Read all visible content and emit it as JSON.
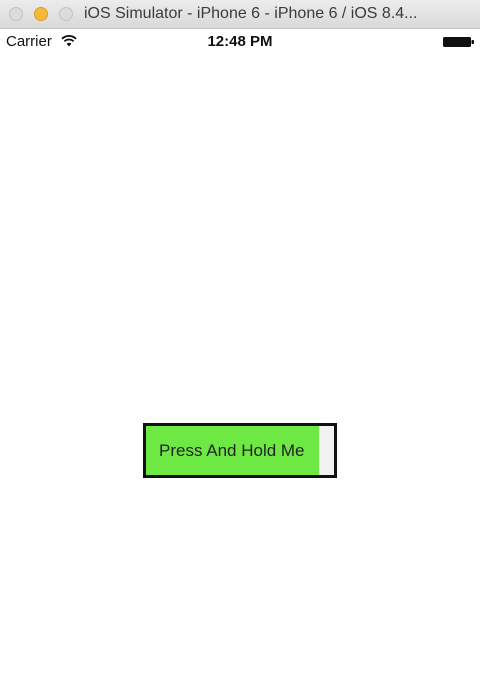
{
  "window": {
    "title": "iOS Simulator - iPhone 6 - iPhone 6 / iOS 8.4..."
  },
  "status_bar": {
    "carrier": "Carrier",
    "time": "12:48 PM",
    "icons": [
      "wifi-icon",
      "battery-icon"
    ]
  },
  "hold_button": {
    "label": "Press And Hold Me",
    "progress": 0.92,
    "progress_color": "#6ee843",
    "border_color": "#111111"
  }
}
